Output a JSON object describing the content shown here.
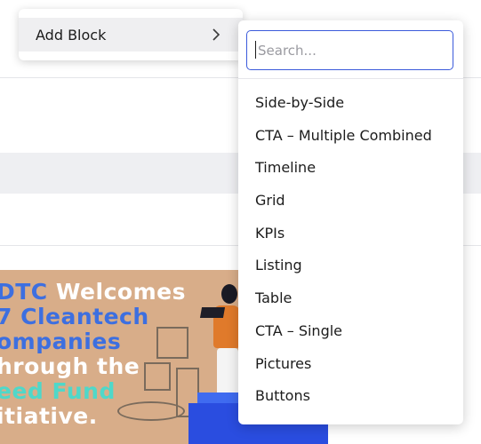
{
  "context_menu": {
    "add_block_label": "Add Block",
    "chevron_icon": "chevron-right-icon"
  },
  "submenu": {
    "search": {
      "placeholder": "Search...",
      "value": ""
    },
    "items": [
      "Side-by-Side",
      "CTA – Multiple Combined",
      "Timeline",
      "Grid",
      "KPIs",
      "Listing",
      "Table",
      "CTA – Single",
      "Pictures",
      "Buttons"
    ]
  },
  "hero_image": {
    "lines": [
      {
        "parts": [
          "DTC ",
          "Welcomes"
        ]
      },
      {
        "parts": [
          "7 Cleantech"
        ]
      },
      {
        "parts": [
          "ompanies"
        ]
      },
      {
        "parts": [
          "hrough the"
        ]
      },
      {
        "parts": [
          "eed Fund"
        ]
      },
      {
        "parts": [
          "itiative."
        ]
      }
    ]
  },
  "colors": {
    "accent": "#3b5bdb",
    "menu_hover": "#efeff1",
    "hero_bg": "#d8ad89",
    "hero_blue": "#3d6fe0",
    "hero_teal": "#4fd8c9"
  }
}
